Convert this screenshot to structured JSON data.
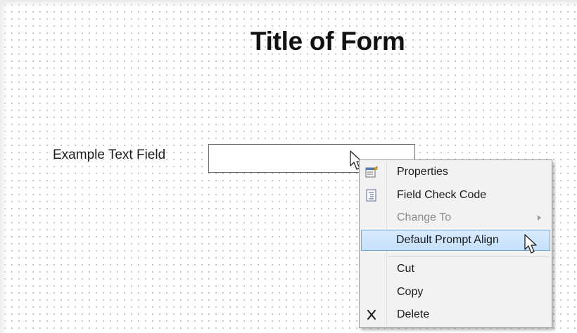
{
  "form": {
    "title": "Title of Form",
    "field_label": "Example Text Field",
    "field_value": ""
  },
  "context_menu": {
    "properties": {
      "label": "Properties",
      "icon": "properties-icon"
    },
    "field_check_code": {
      "label": "Field Check Code",
      "icon": "code-document-icon"
    },
    "change_to": {
      "label": "Change To",
      "enabled": false,
      "has_submenu": true
    },
    "default_prompt_align": {
      "label": "Default Prompt Align",
      "highlighted": true
    },
    "cut": {
      "label": "Cut"
    },
    "copy": {
      "label": "Copy"
    },
    "delete": {
      "label": "Delete",
      "icon": "delete-x-icon"
    }
  },
  "colors": {
    "highlight_fill": "#c4e0fc",
    "highlight_border": "#6ea5d8",
    "menu_background": "#f2f2f2",
    "disabled_text": "#8a8a8a"
  }
}
